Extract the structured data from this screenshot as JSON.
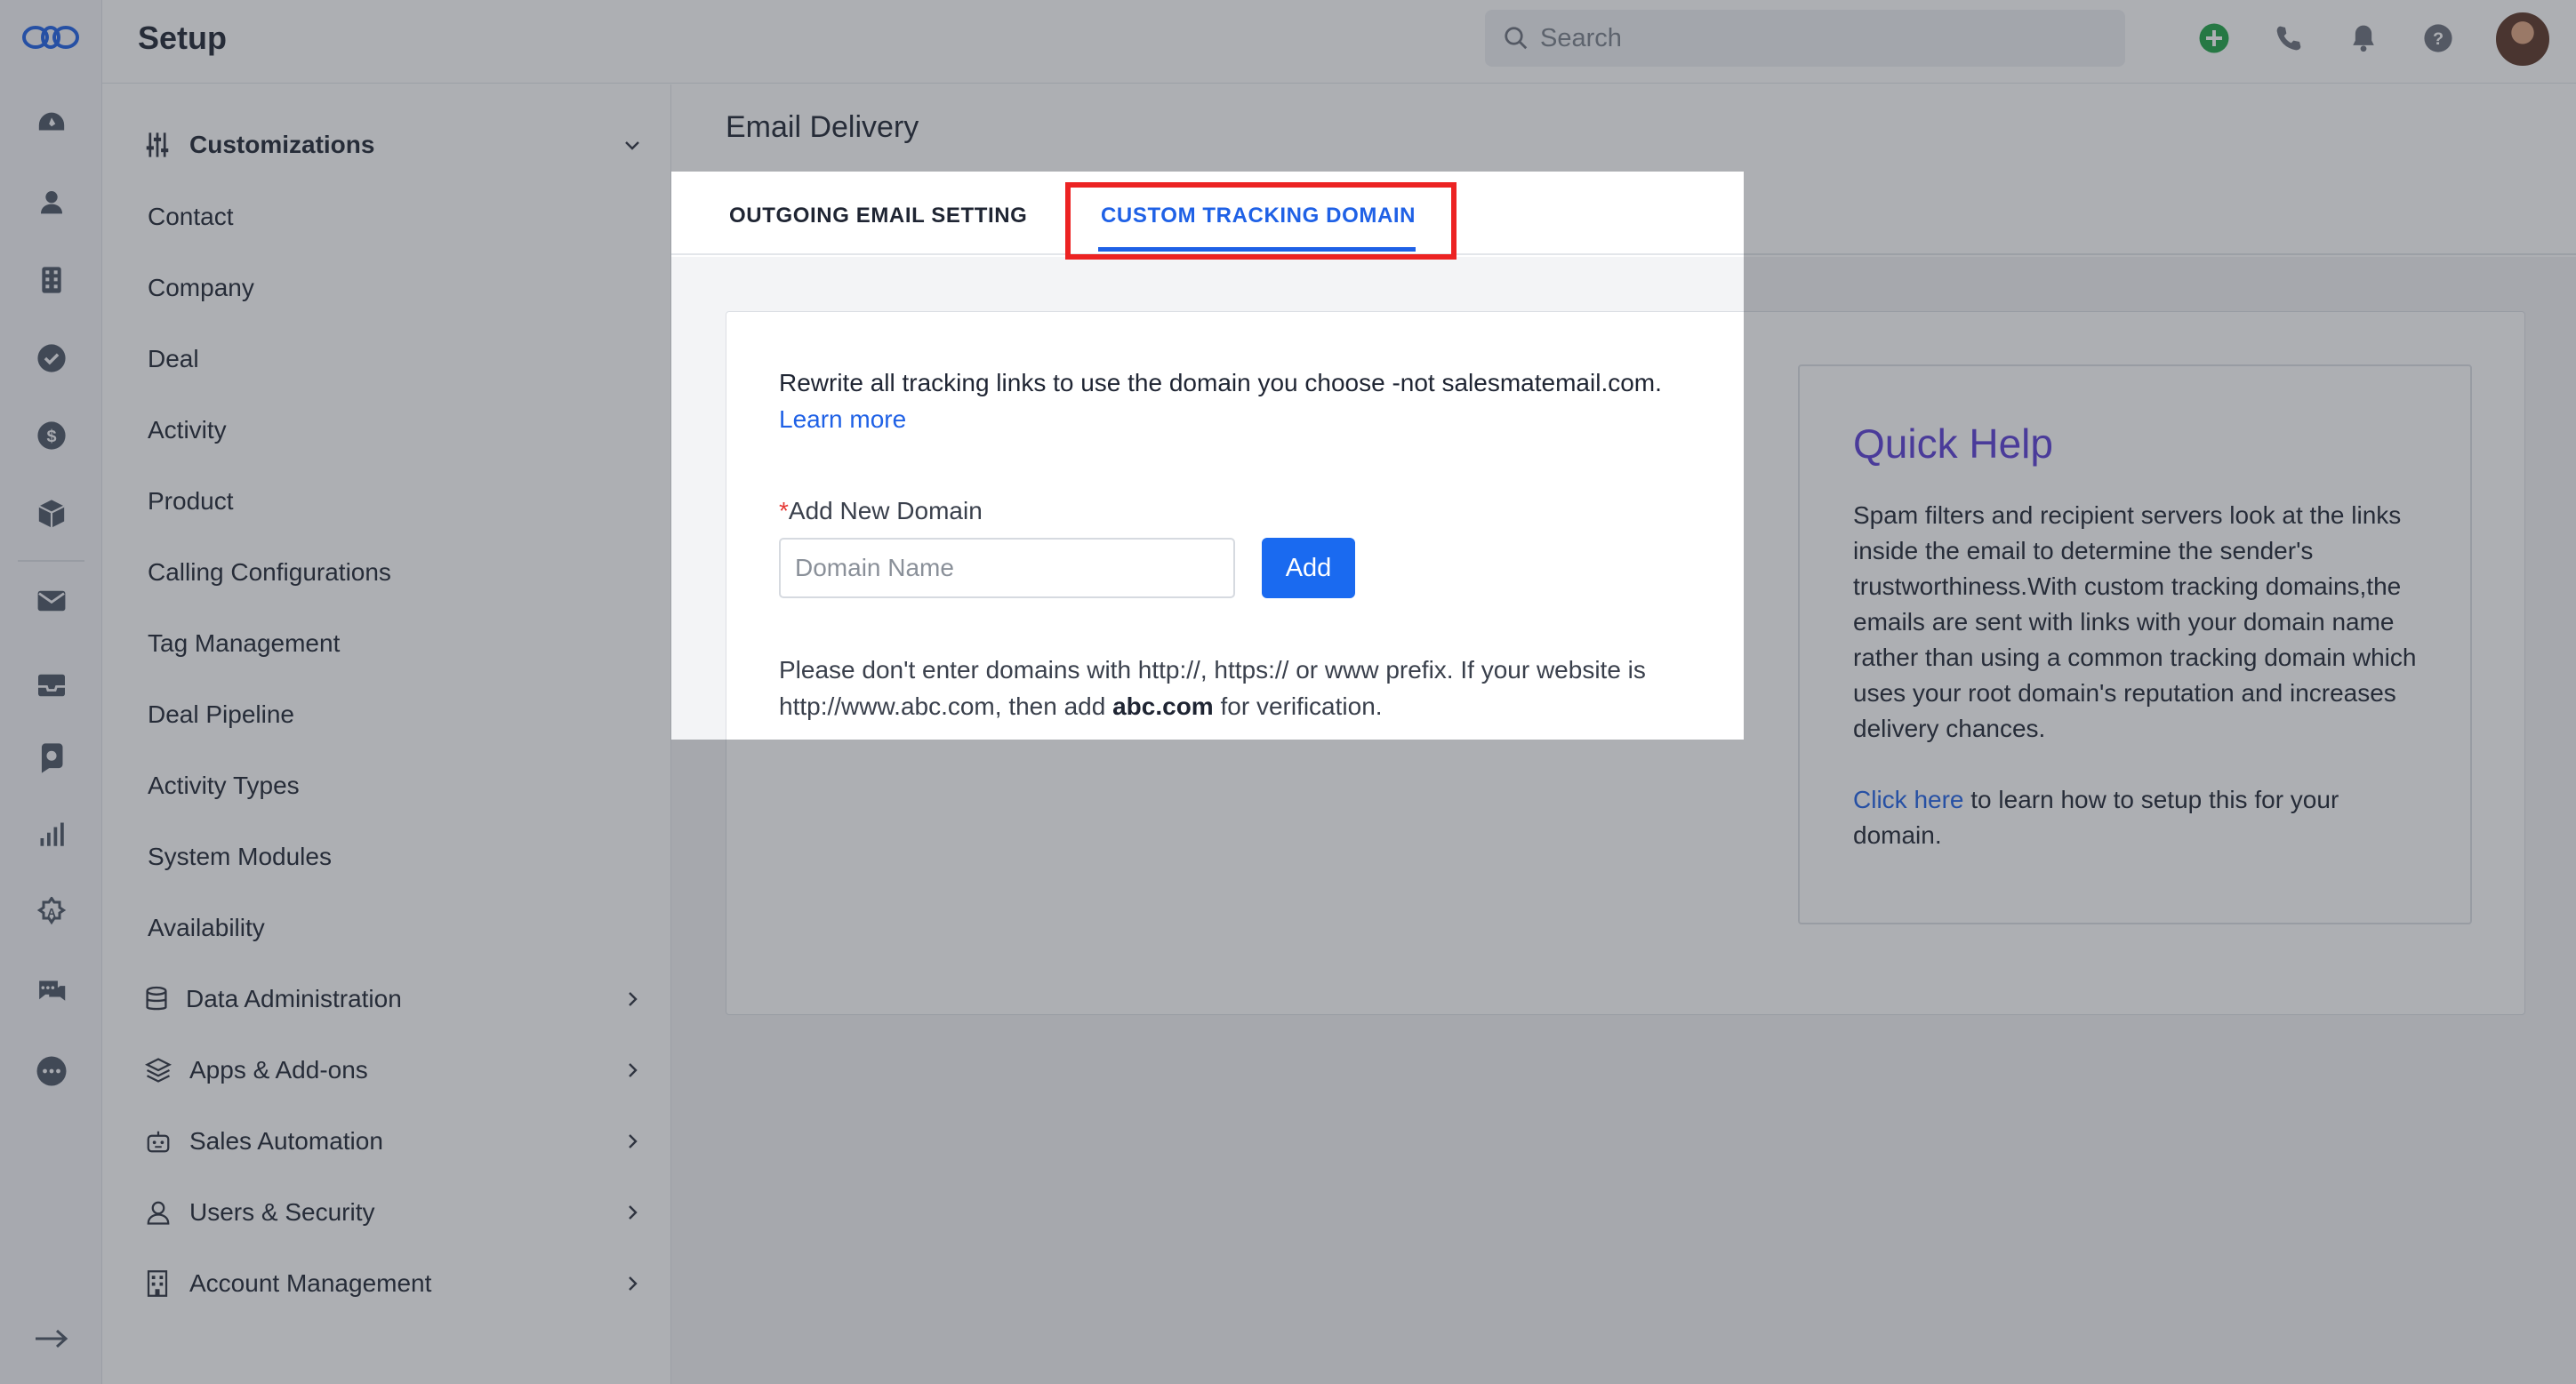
{
  "header": {
    "title": "Setup",
    "search_placeholder": "Search"
  },
  "rail": {
    "icons": [
      "dashboard-icon",
      "contacts-icon",
      "companies-icon",
      "tasks-icon",
      "deals-icon",
      "products-icon",
      "email-icon",
      "inbox-icon",
      "chat-icon",
      "reports-icon",
      "automation-icon",
      "messages-icon",
      "more-icon",
      "expand-icon"
    ]
  },
  "sidebar": {
    "customizations_label": "Customizations",
    "items": [
      "Contact",
      "Company",
      "Deal",
      "Activity",
      "Product",
      "Calling Configurations",
      "Tag Management",
      "Deal Pipeline",
      "Activity Types",
      "System Modules",
      "Availability"
    ],
    "groups": [
      "Data Administration",
      "Apps & Add-ons",
      "Sales Automation",
      "Users & Security",
      "Account Management"
    ]
  },
  "main": {
    "title": "Email Delivery",
    "tabs": [
      "OUTGOING EMAIL SETTING",
      "CUSTOM TRACKING DOMAIN"
    ],
    "active_tab": "CUSTOM TRACKING DOMAIN",
    "description": "Rewrite all tracking links to use the domain you choose -not salesmatemail.com.",
    "learn_more": "Learn more",
    "required_mark": "*",
    "field_label": "Add New Domain",
    "domain_placeholder": "Domain Name",
    "add_button": "Add",
    "note_part1": "Please don't enter domains with http://, https:// or www prefix. If your website is http://www.abc.com, then add",
    "note_bold": "abc.com",
    "note_part2": "for verification."
  },
  "quick_help": {
    "title": "Quick Help",
    "body": "Spam filters and recipient servers look at the links inside the email to determine the sender's trustworthiness.With custom tracking domains,the emails are sent with links with your domain name rather than using a common tracking domain which uses your root domain's reputation and increases delivery chances.",
    "link": "Click here",
    "link_suffix": "to learn how to setup this for your domain."
  },
  "colors": {
    "accent": "#1f61e6",
    "highlight": "#ec2323",
    "quick_help_title": "#5a3fd6",
    "add_action": "#1ea446"
  }
}
